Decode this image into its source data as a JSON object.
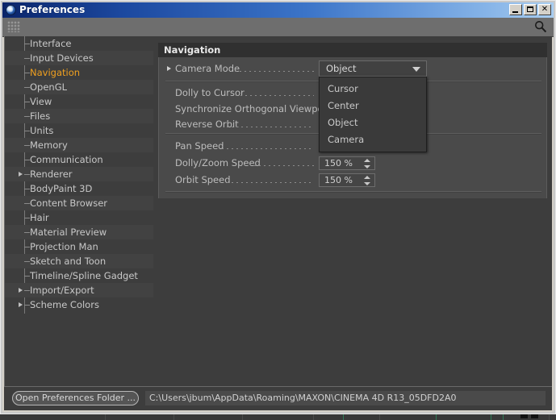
{
  "window": {
    "title": "Preferences",
    "icon": "c4d-logo-icon",
    "controls": {
      "minimize": "_",
      "maximize": "□",
      "close": "✕"
    }
  },
  "toolbar": {
    "grip": "drag-grip-icon",
    "search": "search-icon"
  },
  "sidebar": {
    "items": [
      {
        "label": "Interface",
        "expandable": false,
        "selected": false
      },
      {
        "label": "Input Devices",
        "expandable": false,
        "selected": false
      },
      {
        "label": "Navigation",
        "expandable": false,
        "selected": true
      },
      {
        "label": "OpenGL",
        "expandable": false,
        "selected": false
      },
      {
        "label": "View",
        "expandable": false,
        "selected": false
      },
      {
        "label": "Files",
        "expandable": false,
        "selected": false
      },
      {
        "label": "Units",
        "expandable": false,
        "selected": false
      },
      {
        "label": "Memory",
        "expandable": false,
        "selected": false
      },
      {
        "label": "Communication",
        "expandable": false,
        "selected": false
      },
      {
        "label": "Renderer",
        "expandable": true,
        "selected": false
      },
      {
        "label": "BodyPaint 3D",
        "expandable": false,
        "selected": false
      },
      {
        "label": "Content Browser",
        "expandable": false,
        "selected": false
      },
      {
        "label": "Hair",
        "expandable": false,
        "selected": false
      },
      {
        "label": "Material Preview",
        "expandable": false,
        "selected": false
      },
      {
        "label": "Projection Man",
        "expandable": false,
        "selected": false
      },
      {
        "label": "Sketch and Toon",
        "expandable": false,
        "selected": false
      },
      {
        "label": "Timeline/Spline Gadget",
        "expandable": false,
        "selected": false
      },
      {
        "label": "Import/Export",
        "expandable": true,
        "selected": false
      },
      {
        "label": "Scheme Colors",
        "expandable": true,
        "selected": false
      }
    ]
  },
  "content": {
    "section_title": "Navigation",
    "rows": {
      "camera_mode": "Camera Mode",
      "dolly_to_cursor": "Dolly to Cursor",
      "synchronize_orthogonal_viewports": "Synchronize Orthogonal Viewports",
      "reverse_orbit": "Reverse Orbit",
      "pan_speed": "Pan Speed",
      "dolly_zoom_speed": "Dolly/Zoom Speed",
      "orbit_speed": "Orbit Speed"
    },
    "camera_mode_dropdown": {
      "value": "Object",
      "open": true,
      "options": [
        "Cursor",
        "Center",
        "Object",
        "Camera"
      ]
    },
    "dolly_zoom_speed_value": "150 %",
    "orbit_speed_value": "150 %"
  },
  "bottom": {
    "open_folder_label": "Open Preferences Folder ...",
    "path": "C:\\Users\\jbum\\AppData\\Roaming\\MAXON\\CINEMA 4D R13_05DFD2A0"
  },
  "colors": {
    "accent_selected": "#f0a020",
    "titlebar_start": "#0a246a",
    "titlebar_end": "#a8cdf0",
    "panel_bg": "#3d3d3d",
    "props_bg": "#4a4a4a"
  }
}
